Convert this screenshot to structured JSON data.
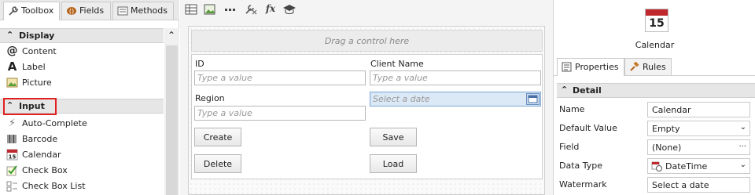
{
  "toolbox": {
    "tabs": [
      {
        "label": "Toolbox",
        "icon": "wrench-icon"
      },
      {
        "label": "Fields",
        "icon": "fields-icon"
      },
      {
        "label": "Methods",
        "icon": "methods-icon"
      }
    ],
    "sections": [
      {
        "label": "Display",
        "items": [
          {
            "label": "Content",
            "icon": "at-sign-icon"
          },
          {
            "label": "Label",
            "icon": "letter-a-icon"
          },
          {
            "label": "Picture",
            "icon": "picture-icon"
          }
        ]
      },
      {
        "label": "Input",
        "items": [
          {
            "label": "Auto-Complete",
            "icon": "lightning-icon"
          },
          {
            "label": "Barcode",
            "icon": "barcode-icon"
          },
          {
            "label": "Calendar",
            "icon": "calendar-icon"
          },
          {
            "label": "Check Box",
            "icon": "checkbox-icon"
          },
          {
            "label": "Check Box List",
            "icon": "checkbox-list-icon"
          }
        ]
      }
    ]
  },
  "canvas": {
    "toolbar": [
      "table-icon",
      "image-edit-icon",
      "dots-icon",
      "rules-icon",
      "fx-icon",
      "graduation-cap-icon"
    ],
    "fx_label": "fx",
    "drop_hint": "Drag a control here",
    "fields": {
      "id_label": "ID",
      "id_placeholder": "Type a value",
      "client_label": "Client Name",
      "client_placeholder": "Type a value",
      "region_label": "Region",
      "region_placeholder": "Type a value",
      "date_placeholder": "Select a date"
    },
    "buttons": {
      "create": "Create",
      "save": "Save",
      "delete": "Delete",
      "load": "Load"
    }
  },
  "properties": {
    "control_name": "Calendar",
    "control_icon_day": "15",
    "tabs": [
      "Properties",
      "Rules"
    ],
    "section": "Detail",
    "rows": [
      {
        "key": "Name",
        "value": "Calendar"
      },
      {
        "key": "Default Value",
        "value": "Empty"
      },
      {
        "key": "Field",
        "value": "(None)"
      },
      {
        "key": "Data Type",
        "value": "DateTime"
      },
      {
        "key": "Watermark",
        "value": "Select a date"
      }
    ],
    "field_more": "···"
  },
  "colors": {
    "accent_red": "#e02020",
    "calendar_red": "#c0282d",
    "selected_input": "#dbe8f5"
  }
}
